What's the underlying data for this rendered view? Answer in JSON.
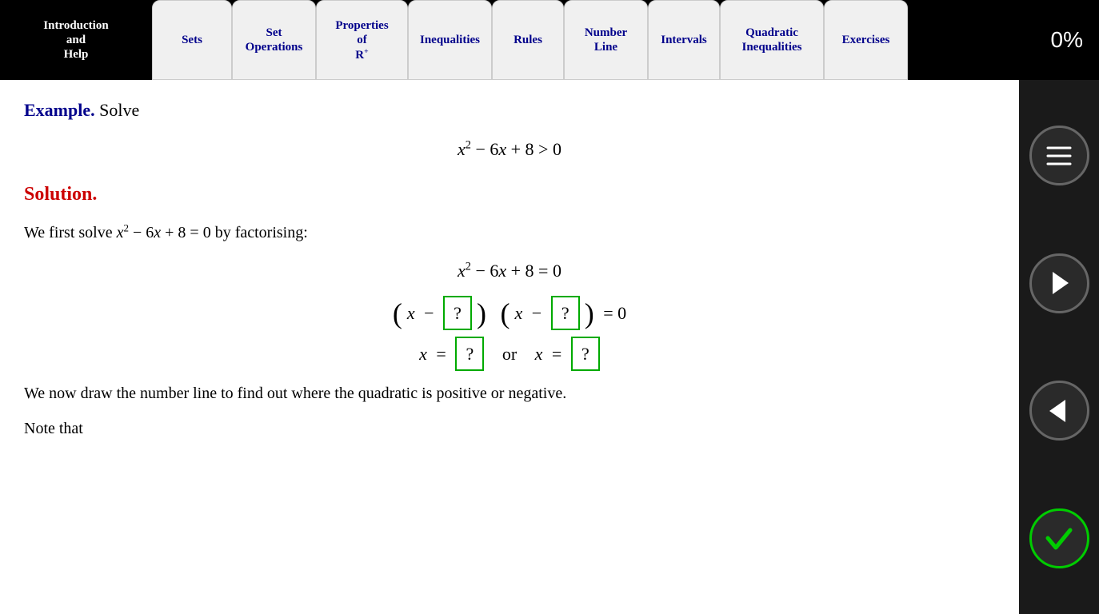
{
  "navbar": {
    "tabs": [
      {
        "id": "intro",
        "label": "Introduction\nand\nHelp",
        "active": true,
        "multiline": [
          "Introduction",
          "and",
          "Help"
        ]
      },
      {
        "id": "sets",
        "label": "Sets",
        "multiline": [
          "Sets"
        ]
      },
      {
        "id": "setops",
        "label": "Set\nOperations",
        "multiline": [
          "Set",
          "Operations"
        ]
      },
      {
        "id": "properties",
        "label": "Properties\nof\nR⁺",
        "multiline": [
          "Properties",
          "of",
          "R⁺"
        ]
      },
      {
        "id": "inequalities",
        "label": "Inequalities",
        "multiline": [
          "Inequalities"
        ]
      },
      {
        "id": "rules",
        "label": "Rules",
        "multiline": [
          "Rules"
        ]
      },
      {
        "id": "numberline",
        "label": "Number\nLine",
        "multiline": [
          "Number",
          "Line"
        ]
      },
      {
        "id": "intervals",
        "label": "Intervals",
        "multiline": [
          "Intervals"
        ]
      },
      {
        "id": "quadratic",
        "label": "Quadratic\nInequalities",
        "multiline": [
          "Quadratic",
          "Inequalities"
        ]
      },
      {
        "id": "exercises",
        "label": "Exercises",
        "multiline": [
          "Exercises"
        ]
      }
    ],
    "percent": "0%"
  },
  "content": {
    "example_label": "Example.",
    "example_text": " Solve",
    "equation_main": "x² − 6x + 8 > 0",
    "solution_label": "Solution.",
    "body_text_1": "We first solve x² − 6x + 8 = 0 by factorising:",
    "eq_step1": "x² − 6x + 8 = 0",
    "eq_step2_prefix": "(x −",
    "eq_step2_box1": "?",
    "eq_step2_mid": ") (x −",
    "eq_step2_box2": "?",
    "eq_step2_suffix": ") = 0",
    "eq_step3_prefix": "x =",
    "eq_step3_box1": "?",
    "eq_step3_or": "or",
    "eq_step3_x": "x =",
    "eq_step3_box2": "?",
    "body_text_2": "We now draw the number line to find out where the quadratic is positive or negative.",
    "body_text_3": "Note that"
  },
  "sidebar": {
    "menu_icon": "≡",
    "next_icon": "→",
    "back_icon": "←",
    "check_icon": "✓"
  }
}
